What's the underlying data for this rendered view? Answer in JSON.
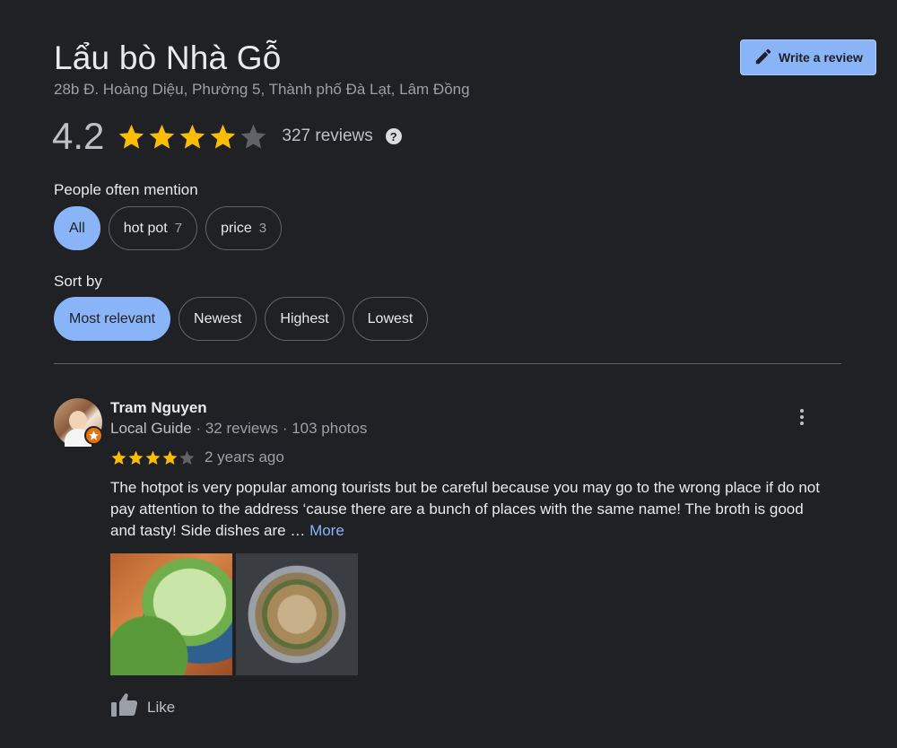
{
  "place": {
    "name": "Lẩu bò Nhà Gỗ",
    "address": "28b Đ. Hoàng Diệu, Phường 5, Thành phố Đà Lạt, Lâm Đồng"
  },
  "write_review": {
    "label": "Write a review",
    "icon": "pencil-icon"
  },
  "rating": {
    "value": "4.2",
    "stars": 4,
    "max_stars": 5,
    "review_count": "327 reviews",
    "help_icon": "?"
  },
  "mentions": {
    "label": "People often mention",
    "chips": [
      {
        "label": "All",
        "count": "",
        "active": true
      },
      {
        "label": "hot pot",
        "count": "7",
        "active": false
      },
      {
        "label": "price",
        "count": "3",
        "active": false
      }
    ]
  },
  "sort": {
    "label": "Sort by",
    "chips": [
      {
        "label": "Most relevant",
        "active": true
      },
      {
        "label": "Newest",
        "active": false
      },
      {
        "label": "Highest",
        "active": false
      },
      {
        "label": "Lowest",
        "active": false
      }
    ]
  },
  "review": {
    "author": "Tram Nguyen",
    "badge": "Local Guide",
    "meta": " · 32 reviews · 103 photos",
    "stars": 4,
    "time": "2 years ago",
    "text": "The hotpot is very popular among tourists but be careful because you may go to the wrong place if do not pay attention to the address ‘cause there are a bunch of places with the same name! The broth is good and tasty! Side dishes are … ",
    "more": "More",
    "like": "Like"
  },
  "colors": {
    "background": "#202124",
    "accent": "#8ab4f8",
    "star": "#fbbc04",
    "star_empty": "#5f6368",
    "guide_badge": "#e8710a"
  }
}
